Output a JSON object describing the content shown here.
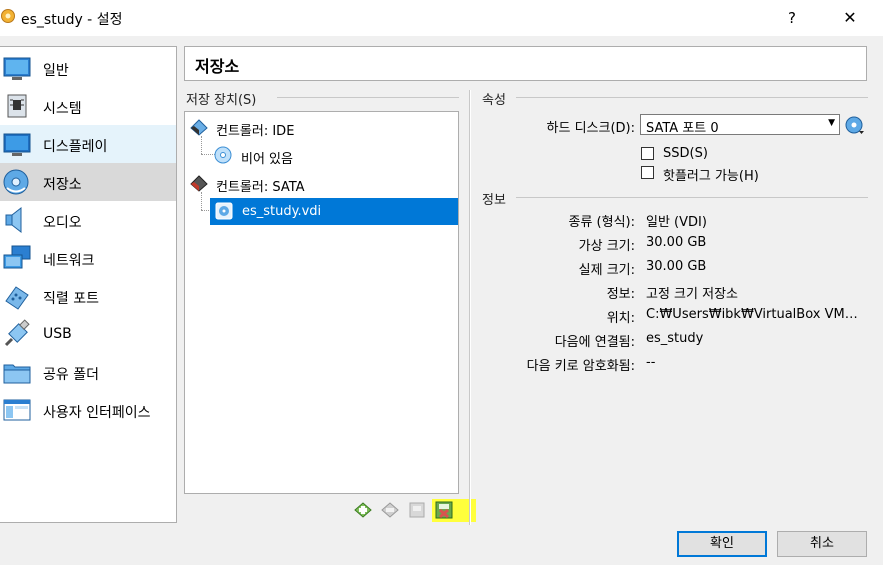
{
  "window": {
    "title": "es_study - 설정",
    "help_label": "?",
    "close_label": "✕"
  },
  "sidebar": {
    "items": [
      {
        "label": "일반",
        "icon": "general-icon"
      },
      {
        "label": "시스템",
        "icon": "system-icon"
      },
      {
        "label": "디스플레이",
        "icon": "display-icon"
      },
      {
        "label": "저장소",
        "icon": "storage-icon"
      },
      {
        "label": "오디오",
        "icon": "audio-icon"
      },
      {
        "label": "네트워크",
        "icon": "network-icon"
      },
      {
        "label": "직렬 포트",
        "icon": "serial-port-icon"
      },
      {
        "label": "USB",
        "icon": "usb-icon"
      },
      {
        "label": "공유 폴더",
        "icon": "shared-folder-icon"
      },
      {
        "label": "사용자 인터페이스",
        "icon": "user-interface-icon"
      }
    ],
    "hover_index": 2,
    "selected_index": 3
  },
  "page": {
    "title": "저장소"
  },
  "storage_devices": {
    "group_label": "저장 장치(S)",
    "tree": [
      {
        "label": "컨트롤러: IDE",
        "type": "controller"
      },
      {
        "label": "비어 있음",
        "type": "optical"
      },
      {
        "label": "컨트롤러: SATA",
        "type": "controller"
      },
      {
        "label": "es_study.vdi",
        "type": "disk",
        "selected": true
      }
    ]
  },
  "attributes": {
    "group_label": "속성",
    "hard_disk_label": "하드 디스크(D):",
    "hard_disk_value": "SATA 포트 0",
    "ssd_label": "SSD(S)",
    "ssd_checked": false,
    "hotplug_label": "핫플러그 가능(H)",
    "hotplug_checked": false
  },
  "info": {
    "group_label": "정보",
    "rows": [
      {
        "label": "종류 (형식):",
        "value": "일반 (VDI)"
      },
      {
        "label": "가상 크기:",
        "value": "30.00 GB"
      },
      {
        "label": "실제 크기:",
        "value": "30.00 GB"
      },
      {
        "label": "정보:",
        "value": "고정 크기 저장소"
      },
      {
        "label": "위치:",
        "value": "C:₩Users₩ibk₩VirtualBox VM…"
      },
      {
        "label": "다음에 연결됨:",
        "value": "es_study"
      },
      {
        "label": "다음 키로 암호화됨:",
        "value": "--"
      }
    ]
  },
  "buttons": {
    "ok": "확인",
    "cancel": "취소"
  },
  "colors": {
    "selection": "#0078d7",
    "hover": "#e5f3fb",
    "highlight": "#ffff3c"
  }
}
